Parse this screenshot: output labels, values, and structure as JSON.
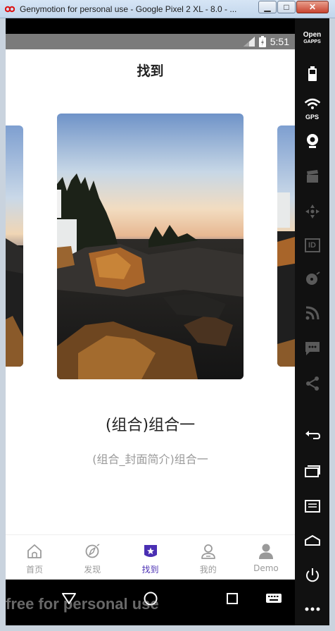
{
  "window": {
    "title": "Genymotion for personal use - Google Pixel 2 XL - 8.0 - ...",
    "min_label": "▁",
    "max_label": "□",
    "close_label": "✕"
  },
  "status": {
    "time": "5:51"
  },
  "page": {
    "title": "找到"
  },
  "card": {
    "name": "(组合)组合一",
    "description": "(组合_封面简介)组合一"
  },
  "tabs": [
    {
      "label": "首页",
      "icon": "home-icon"
    },
    {
      "label": "发现",
      "icon": "compass-icon"
    },
    {
      "label": "找到",
      "icon": "star-badge-icon",
      "active": true
    },
    {
      "label": "我的",
      "icon": "person-outline-icon"
    },
    {
      "label": "Demo",
      "icon": "person-filled-icon"
    }
  ],
  "watermark": "free for personal use",
  "toolbar": {
    "opengapps_line1": "Open",
    "opengapps_line2": "GAPPS",
    "gps_label": "GPS",
    "id_label": "ID"
  },
  "colors": {
    "accent": "#4a2fb3",
    "inactive": "#9a9a9a",
    "statusbar": "#7b7b7b"
  }
}
